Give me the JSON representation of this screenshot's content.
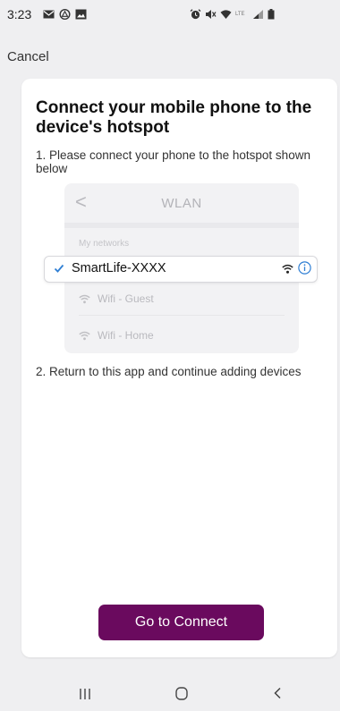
{
  "status_bar": {
    "time": "3:23",
    "left_icons": [
      "mail-icon",
      "drive-icon",
      "image-icon"
    ],
    "right_icons": [
      "alarm-icon",
      "mute-icon",
      "wifi-icon",
      "lte-icon",
      "signal-icon",
      "battery-icon"
    ]
  },
  "header": {
    "cancel_label": "Cancel"
  },
  "card": {
    "title": "Connect your mobile phone to the device's hotspot",
    "step1": "1. Please connect your phone to the hotspot shown below",
    "illustration": {
      "back_glyph": "<",
      "title": "WLAN",
      "section_label": "My networks",
      "selected_network": "SmartLife-XXXX",
      "other_networks": [
        "Wifi - Guest",
        "Wifi - Home"
      ]
    },
    "step2": "2. Return to this app and continue adding devices",
    "connect_label": "Go to Connect"
  },
  "nav_bar": {
    "icons": [
      "recents-icon",
      "home-icon",
      "back-icon"
    ]
  },
  "colors": {
    "accent": "#6a0a5e",
    "check": "#2f7fd4",
    "background": "#efeff1",
    "card": "#ffffff"
  }
}
